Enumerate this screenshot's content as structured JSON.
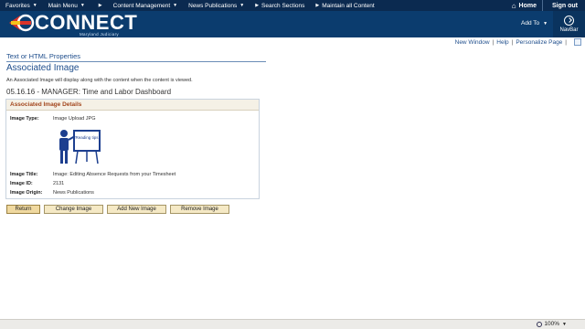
{
  "topbar": {
    "menus": [
      {
        "label": "Favorites",
        "caret": true
      },
      {
        "label": "Main Menu",
        "caret": true
      },
      {
        "label": "",
        "caret": true
      },
      {
        "label": "Content Management",
        "caret": true
      },
      {
        "label": "News Publications",
        "caret": true
      },
      {
        "label": "Search Sections",
        "caret": false
      },
      {
        "label": "Maintain all Content",
        "caret": false
      }
    ],
    "home_label": "Home",
    "signout_label": "Sign out"
  },
  "banner": {
    "logo_text": "CONNECT",
    "logo_sub": "Maryland Judiciary",
    "addto_label": "Add To",
    "navbar_label": "NavBar"
  },
  "toplinks": {
    "new_window": "New Window",
    "help": "Help",
    "personalize": "Personalize Page",
    "sep": "|"
  },
  "page": {
    "breadcrumb": "Text or HTML Properties",
    "title": "Associated Image",
    "description": "An Associated Image will display along with the content when the content is viewed.",
    "subtitle": "05.16.16 - MANAGER: Time and Labor Dashboard"
  },
  "panel": {
    "header": "Associated Image Details",
    "image_type_label": "Image Type:",
    "image_type_value": "Image Upload JPG",
    "image_caption": "Reading tips",
    "image_title_label": "Image Title:",
    "image_title_value": "Image: Editing Absence Requests from your Timesheet",
    "image_id_label": "Image ID:",
    "image_id_value": "2131",
    "image_origin_label": "Image Origin:",
    "image_origin_value": "News Publications"
  },
  "buttons": {
    "return": "Return",
    "change": "Change Image",
    "add_new": "Add New Image",
    "remove": "Remove Image"
  },
  "status": {
    "zoom": "100%"
  },
  "colors": {
    "topbar": "#0b2a50",
    "banner": "#0b3c6e",
    "link": "#1f4e8c",
    "panel_header_text": "#a3461d",
    "button_fill": "#f5e9c5"
  }
}
